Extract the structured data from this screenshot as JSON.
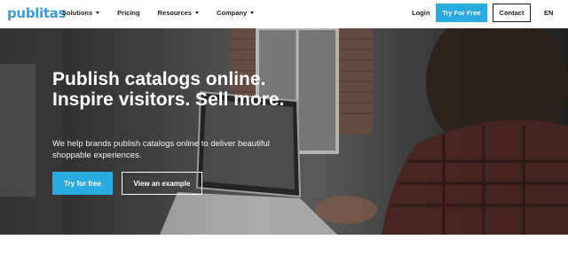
{
  "nav": {
    "logo": "publitas",
    "menu": [
      {
        "label": "Solutions",
        "dropdown": true
      },
      {
        "label": "Pricing",
        "dropdown": false
      },
      {
        "label": "Resources",
        "dropdown": true
      },
      {
        "label": "Company",
        "dropdown": true
      }
    ],
    "login": "Login",
    "try_free": "Try For Free",
    "contact": "Contact",
    "language": "EN"
  },
  "hero": {
    "headline": "Publish catalogs online. Inspire visitors. Sell more.",
    "subtext": "We help brands publish catalogs online to deliver beautiful shoppable experiences.",
    "primary_cta": "Try for free",
    "secondary_cta": "View an example"
  },
  "colors": {
    "accent": "#29abe2",
    "text_dark": "#1d1d1d",
    "logo": "#3d9bd6"
  }
}
